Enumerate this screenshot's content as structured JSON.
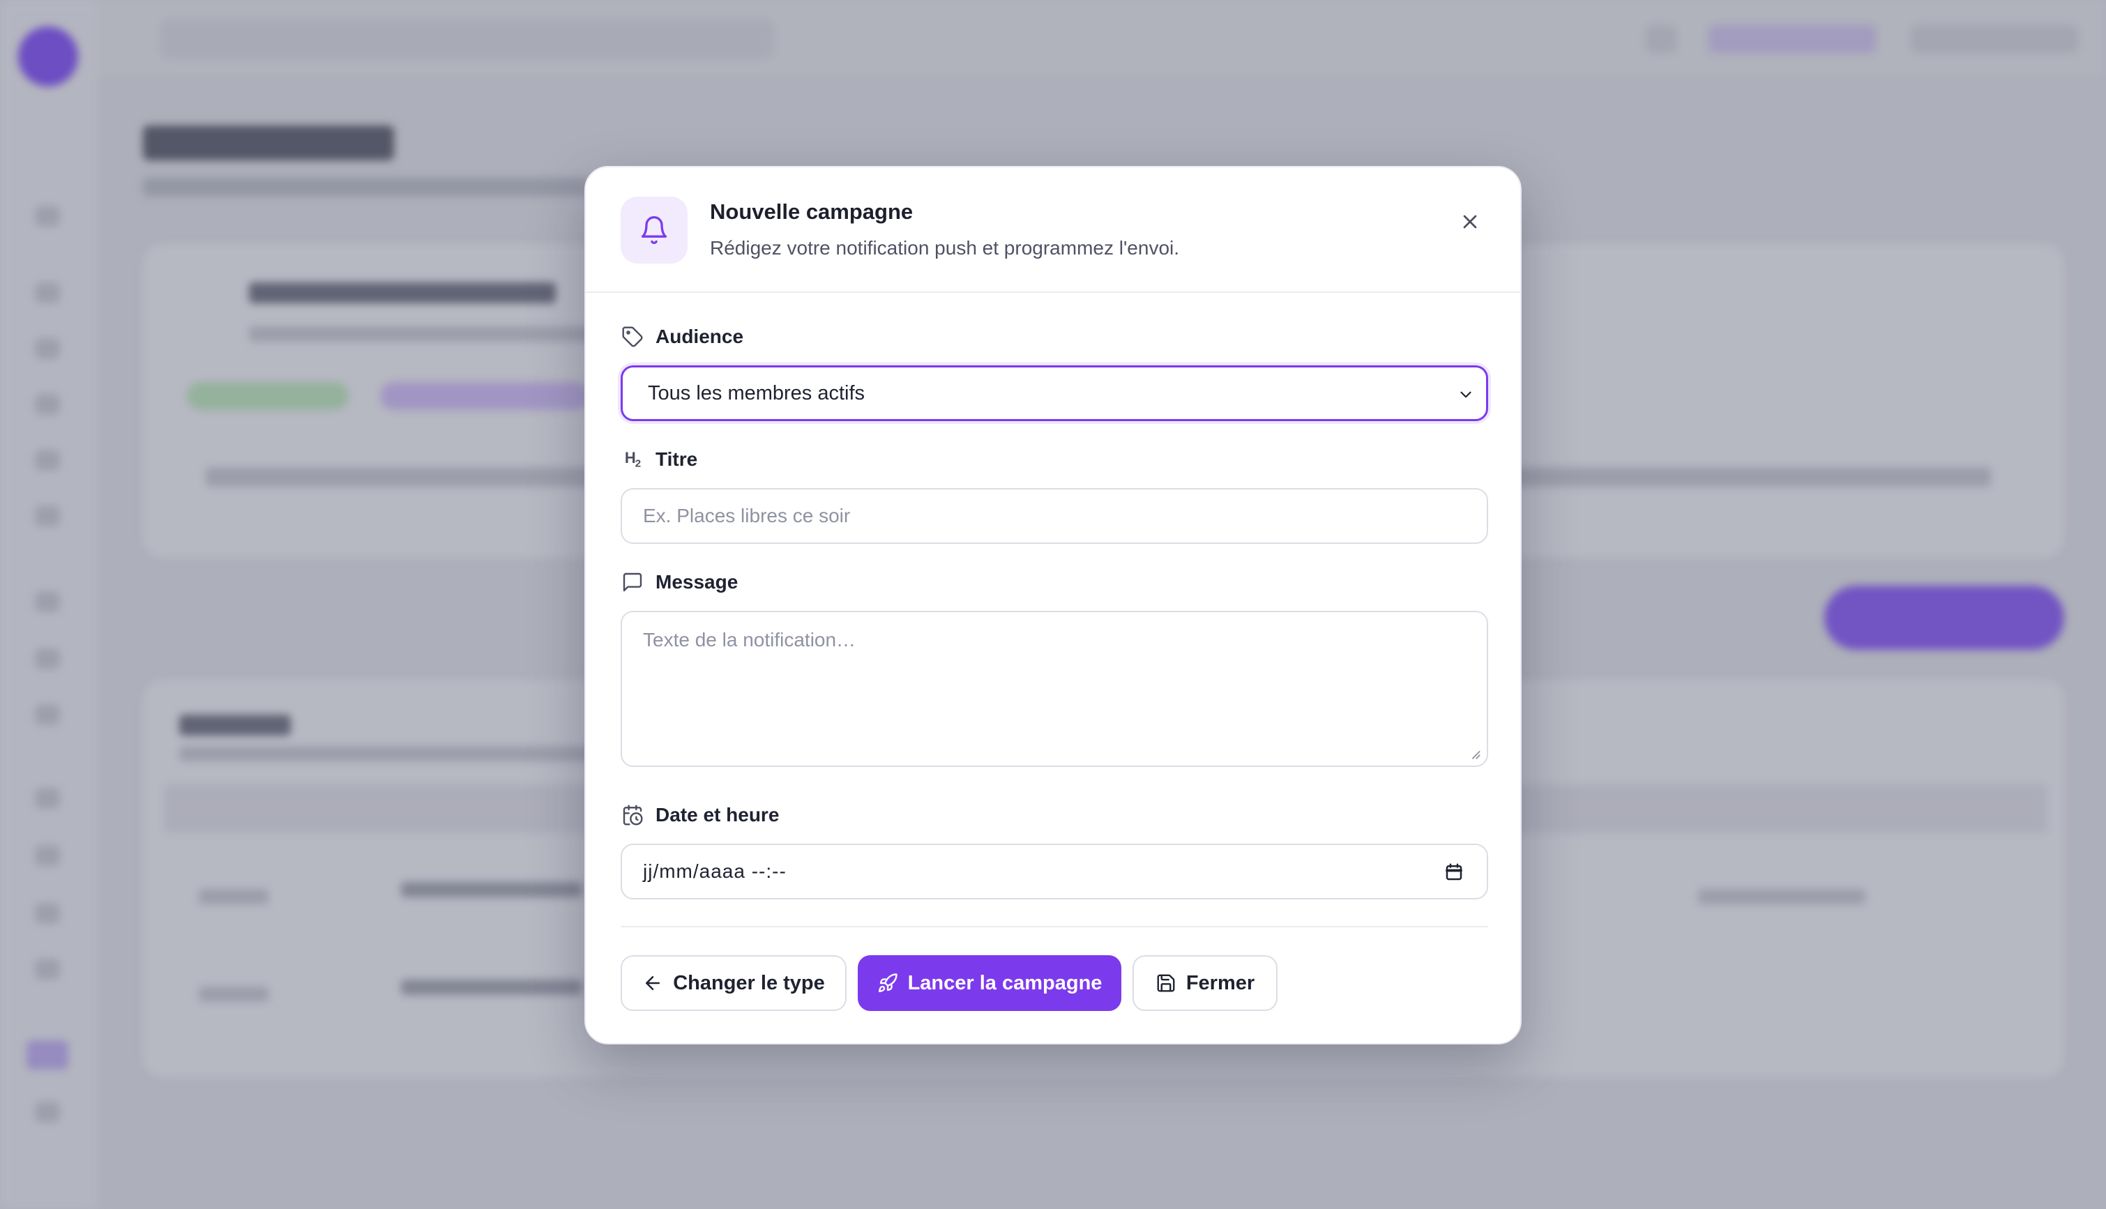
{
  "modal": {
    "title": "Nouvelle campagne",
    "subtitle": "Rédigez votre notification push et programmez l'envoi.",
    "audience": {
      "label": "Audience",
      "selected": "Tous les membres actifs"
    },
    "titre": {
      "label": "Titre",
      "placeholder": "Ex. Places libres ce soir"
    },
    "message": {
      "label": "Message",
      "placeholder": "Texte de la notification…"
    },
    "date": {
      "label": "Date et heure",
      "value": "jj/mm/aaaa --:--"
    },
    "actions": {
      "back_label": "Changer le type",
      "launch_label": "Lancer la campagne",
      "close_label": "Fermer"
    }
  },
  "colors": {
    "accent": "#7c3aed",
    "accent_soft": "#f1ebfd",
    "border": "#dcdde5"
  },
  "icons": {
    "header": "bell-icon",
    "close": "close-icon",
    "audience": "tag-icon",
    "titre": "heading-h2-icon",
    "message": "message-square-icon",
    "date": "calendar-clock-icon",
    "back": "arrow-left-icon",
    "launch": "rocket-icon",
    "save": "save-icon"
  }
}
